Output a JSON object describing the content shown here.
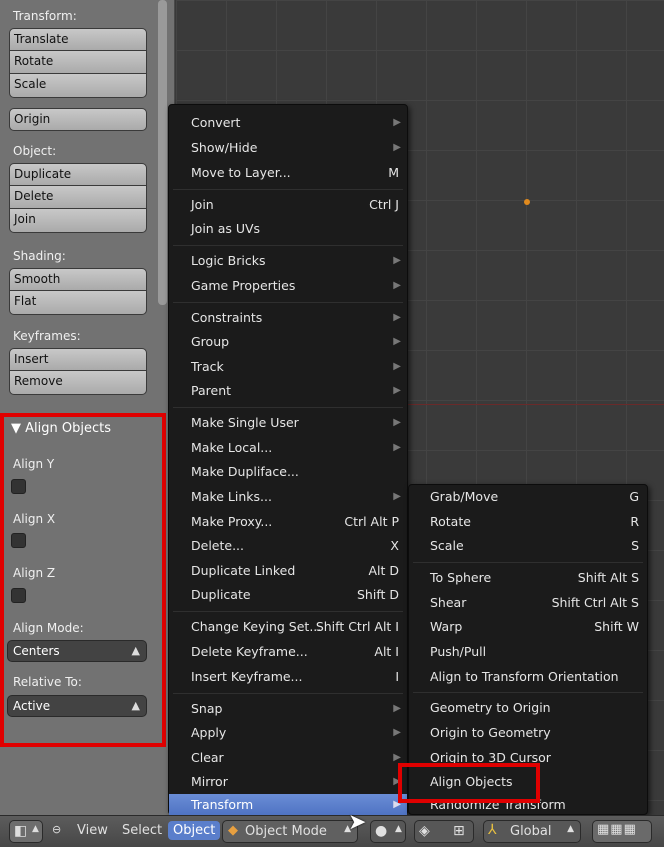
{
  "toolshelf": {
    "transform_label": "Transform:",
    "translate": "Translate",
    "rotate": "Rotate",
    "scale": "Scale",
    "origin": "Origin",
    "object_label": "Object:",
    "duplicate": "Duplicate",
    "delete": "Delete",
    "join": "Join",
    "shading_label": "Shading:",
    "smooth": "Smooth",
    "flat": "Flat",
    "keyframes_label": "Keyframes:",
    "insert": "Insert",
    "remove": "Remove"
  },
  "align_panel": {
    "title": "Align Objects",
    "align_y": "Align Y",
    "align_x": "Align X",
    "align_z": "Align Z",
    "align_mode_label": "Align Mode:",
    "align_mode_value": "Centers",
    "relative_to_label": "Relative To:",
    "relative_to_value": "Active"
  },
  "object_menu": {
    "convert": "Convert",
    "show_hide": "Show/Hide",
    "move_to_layer": "Move to Layer...",
    "move_to_layer_sc": "M",
    "join": "Join",
    "join_sc": "Ctrl J",
    "join_as_uvs": "Join as UVs",
    "logic_bricks": "Logic Bricks",
    "game_properties": "Game Properties",
    "constraints": "Constraints",
    "group": "Group",
    "track": "Track",
    "parent": "Parent",
    "make_single_user": "Make Single User",
    "make_local": "Make Local...",
    "make_dupliface": "Make Dupliface...",
    "make_links": "Make Links...",
    "make_proxy": "Make Proxy...",
    "make_proxy_sc": "Ctrl Alt P",
    "delete": "Delete...",
    "delete_sc": "X",
    "duplicate_linked": "Duplicate Linked",
    "duplicate_linked_sc": "Alt D",
    "duplicate": "Duplicate",
    "duplicate_sc": "Shift D",
    "change_keying_set": "Change Keying Set...",
    "change_keying_set_sc": "Shift Ctrl Alt I",
    "delete_keyframe": "Delete Keyframe...",
    "delete_keyframe_sc": "Alt I",
    "insert_keyframe": "Insert Keyframe...",
    "insert_keyframe_sc": "I",
    "snap": "Snap",
    "apply": "Apply",
    "clear": "Clear",
    "mirror": "Mirror",
    "transform": "Transform"
  },
  "transform_menu": {
    "grab_move": "Grab/Move",
    "grab_move_sc": "G",
    "rotate": "Rotate",
    "rotate_sc": "R",
    "scale": "Scale",
    "scale_sc": "S",
    "to_sphere": "To Sphere",
    "to_sphere_sc": "Shift Alt S",
    "shear": "Shear",
    "shear_sc": "Shift Ctrl Alt S",
    "warp": "Warp",
    "warp_sc": "Shift W",
    "push_pull": "Push/Pull",
    "align_to_transform_orientation": "Align to Transform Orientation",
    "geometry_to_origin": "Geometry to Origin",
    "origin_to_geometry": "Origin to Geometry",
    "origin_to_3d_cursor": "Origin to 3D Cursor",
    "align_objects": "Align Objects",
    "randomize_transform": "Randomize Transform"
  },
  "header": {
    "view": "View",
    "select": "Select",
    "object": "Object",
    "mode": "Object Mode",
    "orientation": "Global"
  },
  "colors": {
    "highlight": "#5a7ecb",
    "red_outline": "#e00000"
  }
}
